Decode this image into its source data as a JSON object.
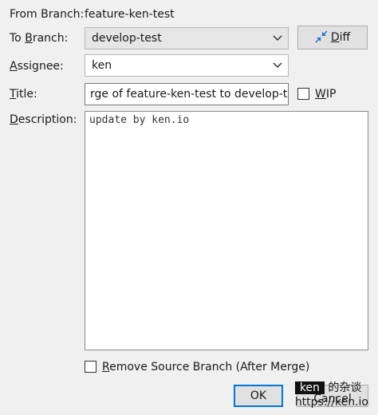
{
  "from_branch": {
    "label": "From Branch:",
    "value": "feature-ken-test"
  },
  "to_branch": {
    "label_pre": "To ",
    "label_hot": "B",
    "label_post": "ranch:",
    "selected": "develop-test"
  },
  "diff_button": {
    "label_hot": "D",
    "label_post": "iff"
  },
  "assignee": {
    "label_hot": "A",
    "label_post": "ssignee:",
    "selected": "ken"
  },
  "title": {
    "label_hot": "T",
    "label_post": "itle:",
    "value": "rge of feature-ken-test to develop-test"
  },
  "wip": {
    "label_hot": "W",
    "label_post": "IP"
  },
  "description": {
    "label_hot": "D",
    "label_post": "escription:",
    "value": "update by ken.io"
  },
  "remove_source": {
    "label_hot": "R",
    "label_post": "emove Source Branch (After Merge)"
  },
  "ok_button": {
    "label": "OK"
  },
  "cancel_button": {
    "label": "Cancel"
  },
  "watermark": {
    "brand": "ken",
    "suffix": "的杂谈",
    "url": "https://ken.io"
  },
  "colors": {
    "diff_icon": "#1e6fd9",
    "accent_focus": "#0078d7"
  }
}
